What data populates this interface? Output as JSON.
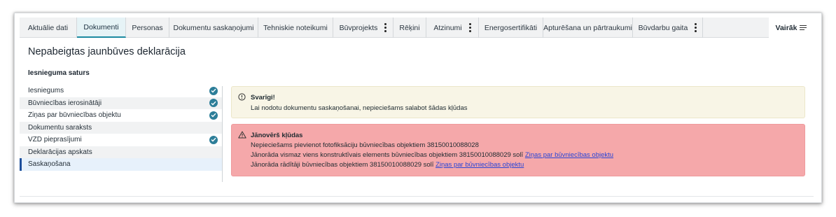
{
  "tabs": [
    {
      "label": "Aktuālie dati",
      "active": false,
      "kebab": false
    },
    {
      "label": "Dokumenti",
      "active": true,
      "kebab": false
    },
    {
      "label": "Personas",
      "active": false,
      "kebab": false
    },
    {
      "label": "Dokumentu saskaņojumi",
      "active": false,
      "kebab": false
    },
    {
      "label": "Tehniskie noteikumi",
      "active": false,
      "kebab": false
    },
    {
      "label": "Būvprojekts",
      "active": false,
      "kebab": true
    },
    {
      "label": "Rēķini",
      "active": false,
      "kebab": false
    },
    {
      "label": "Atzinumi",
      "active": false,
      "kebab": true
    },
    {
      "label": "Energosertifikāti",
      "active": false,
      "kebab": false
    },
    {
      "label": "Apturēšana un pārtraukumi",
      "active": false,
      "kebab": false
    },
    {
      "label": "Būvdarbu gaita",
      "active": false,
      "kebab": true
    }
  ],
  "more_label": "Vairāk",
  "page_title": "Nepabeigtas jaunbūves deklarācija",
  "section_title": "Iesnieguma saturs",
  "nav_items": [
    {
      "label": "Iesniegums",
      "done": true
    },
    {
      "label": "Būvniecības ierosinātāji",
      "done": true
    },
    {
      "label": "Ziņas par būvniecības objektu",
      "done": true
    },
    {
      "label": "Dokumentu saraksts",
      "done": false
    },
    {
      "label": "VZD pieprasījumi",
      "done": true
    },
    {
      "label": "Deklarācijas apskats",
      "done": false
    },
    {
      "label": "Saskaņošana",
      "done": false,
      "active": true
    }
  ],
  "warning": {
    "title": "Svarīgi!",
    "text": "Lai nodotu dokumentu saskaņošanai, nepieciešams salabot šādas kļūdas"
  },
  "errors": {
    "title": "Jānovērš kļūdas",
    "line1": "Nepieciešams pievienot fotofiksāciju būvniecības objektiem 38150010088028",
    "line2_text": "Jānorāda vismaz viens konstruktīvais elements būvniecības objektiem 38150010088029 solī",
    "line2_link": "Ziņas par būvniecības objektu",
    "line3_text": "Jānorāda rādītāji būvniecības objektiem 38150010088029 solī",
    "line3_link": "Ziņas par būvniecības objektu"
  },
  "colors": {
    "active_tab_accent": "#1c8aa0",
    "check_badge": "#2d7e99",
    "warning_bg": "#f8f5e6",
    "error_bg": "#f5a8aa",
    "link": "#2a45d6"
  }
}
